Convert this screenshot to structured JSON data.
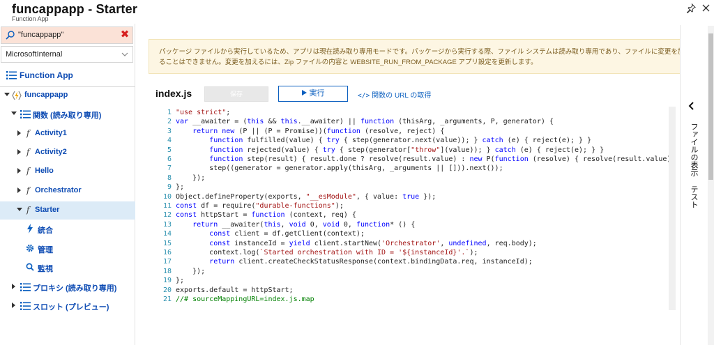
{
  "header": {
    "title": "funcappapp - Starter",
    "subtitle": "Function App"
  },
  "sidebar": {
    "search_value": "\"funcappapp\"",
    "subscription": "MicrosoftInternal",
    "function_apps_label": "Function App",
    "tree": {
      "app": "funcappapp",
      "functions": "関数 (読み取り専用)",
      "items": [
        "Activity1",
        "Activity2",
        "Hello",
        "Orchestrator",
        "Starter"
      ],
      "starter_children": [
        "統合",
        "管理",
        "監視"
      ],
      "proxies": "プロキシ (読み取り専用)",
      "slots": "スロット (プレビュー)"
    },
    "selected": "Starter"
  },
  "notice": {
    "text": "パッケージ ファイルから実行しているため、アプリは現在読み取り専用モードです。パッケージから実行する際、ファイル システムは読み取り専用であり、ファイルに変更を加えることはできません。変更を加えるには、Zip ファイルの内容と WEBSITE_RUN_FROM_PACKAGE アプリ設定を更新します。"
  },
  "editor": {
    "file_name": "index.js",
    "save_label": "保存",
    "run_label": "実行",
    "get_url_icon": "</>",
    "get_url_label": "関数の URL の取得",
    "line_numbers": [
      "1",
      "2",
      "3",
      "4",
      "5",
      "6",
      "7",
      "8",
      "9",
      "10",
      "11",
      "12",
      "13",
      "14",
      "15",
      "16",
      "17",
      "18",
      "19",
      "20",
      "21"
    ],
    "lines": [
      "\"use strict\";",
      "var __awaiter = (this && this.__awaiter) || function (thisArg, _arguments, P, generator) {",
      "    return new (P || (P = Promise))(function (resolve, reject) {",
      "        function fulfilled(value) { try { step(generator.next(value)); } catch (e) { reject(e); } }",
      "        function rejected(value) { try { step(generator[\"throw\"](value)); } catch (e) { reject(e); } }",
      "        function step(result) { result.done ? resolve(result.value) : new P(function (resolve) { resolve(result.value); }).then(fulfilled, rejected); }",
      "        step((generator = generator.apply(thisArg, _arguments || [])).next());",
      "    });",
      "};",
      "Object.defineProperty(exports, \"__esModule\", { value: true });",
      "const df = require(\"durable-functions\");",
      "const httpStart = function (context, req) {",
      "    return __awaiter(this, void 0, void 0, function* () {",
      "        const client = df.getClient(context);",
      "        const instanceId = yield client.startNew('Orchestrator', undefined, req.body);",
      "        context.log(`Started orchestration with ID = '${instanceId}'.`);",
      "        return client.createCheckStatusResponse(context.bindingData.req, instanceId);",
      "    });",
      "};",
      "exports.default = httpStart;",
      "//# sourceMappingURL=index.js.map"
    ]
  },
  "right_panel": {
    "tabs": [
      "ファイルの表示",
      "テスト"
    ]
  },
  "icons": [
    "pin-icon",
    "close-icon",
    "search-icon",
    "clear-icon",
    "chevron-down-icon",
    "list-icon",
    "function-app-icon",
    "function-icon",
    "bolt-icon",
    "gear-icon",
    "magnifier-icon",
    "play-icon",
    "chevron-left-icon"
  ],
  "colors": {
    "accent": "#0b5fbf",
    "notice_bg": "#fdf6e3",
    "selected_bg": "#dcebf7",
    "search_bg": "#fbe2d7"
  }
}
